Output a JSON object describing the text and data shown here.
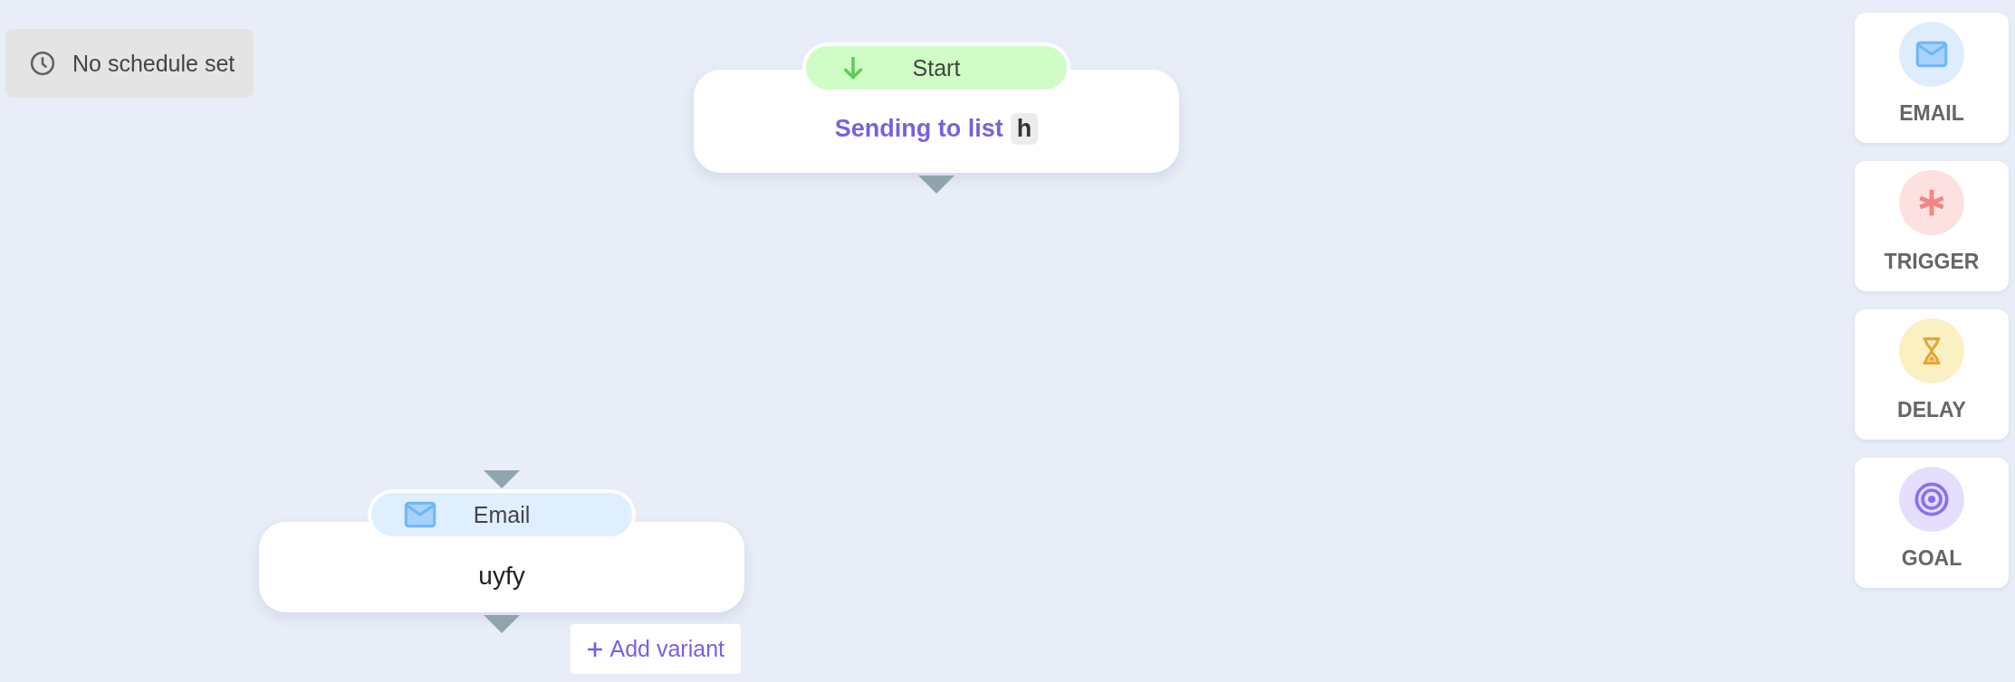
{
  "schedule": {
    "label": "No schedule set"
  },
  "nodes": [
    {
      "kind": "start",
      "title": "Start",
      "text": "Sending to list",
      "tag": "h"
    },
    {
      "kind": "email",
      "title": "Email",
      "text": "uyfy",
      "action": "Add variant"
    }
  ],
  "palette": [
    {
      "kind": "email",
      "label": "EMAIL"
    },
    {
      "kind": "trigger",
      "label": "TRIGGER"
    },
    {
      "kind": "delay",
      "label": "DELAY"
    },
    {
      "kind": "goal",
      "label": "GOAL"
    }
  ]
}
